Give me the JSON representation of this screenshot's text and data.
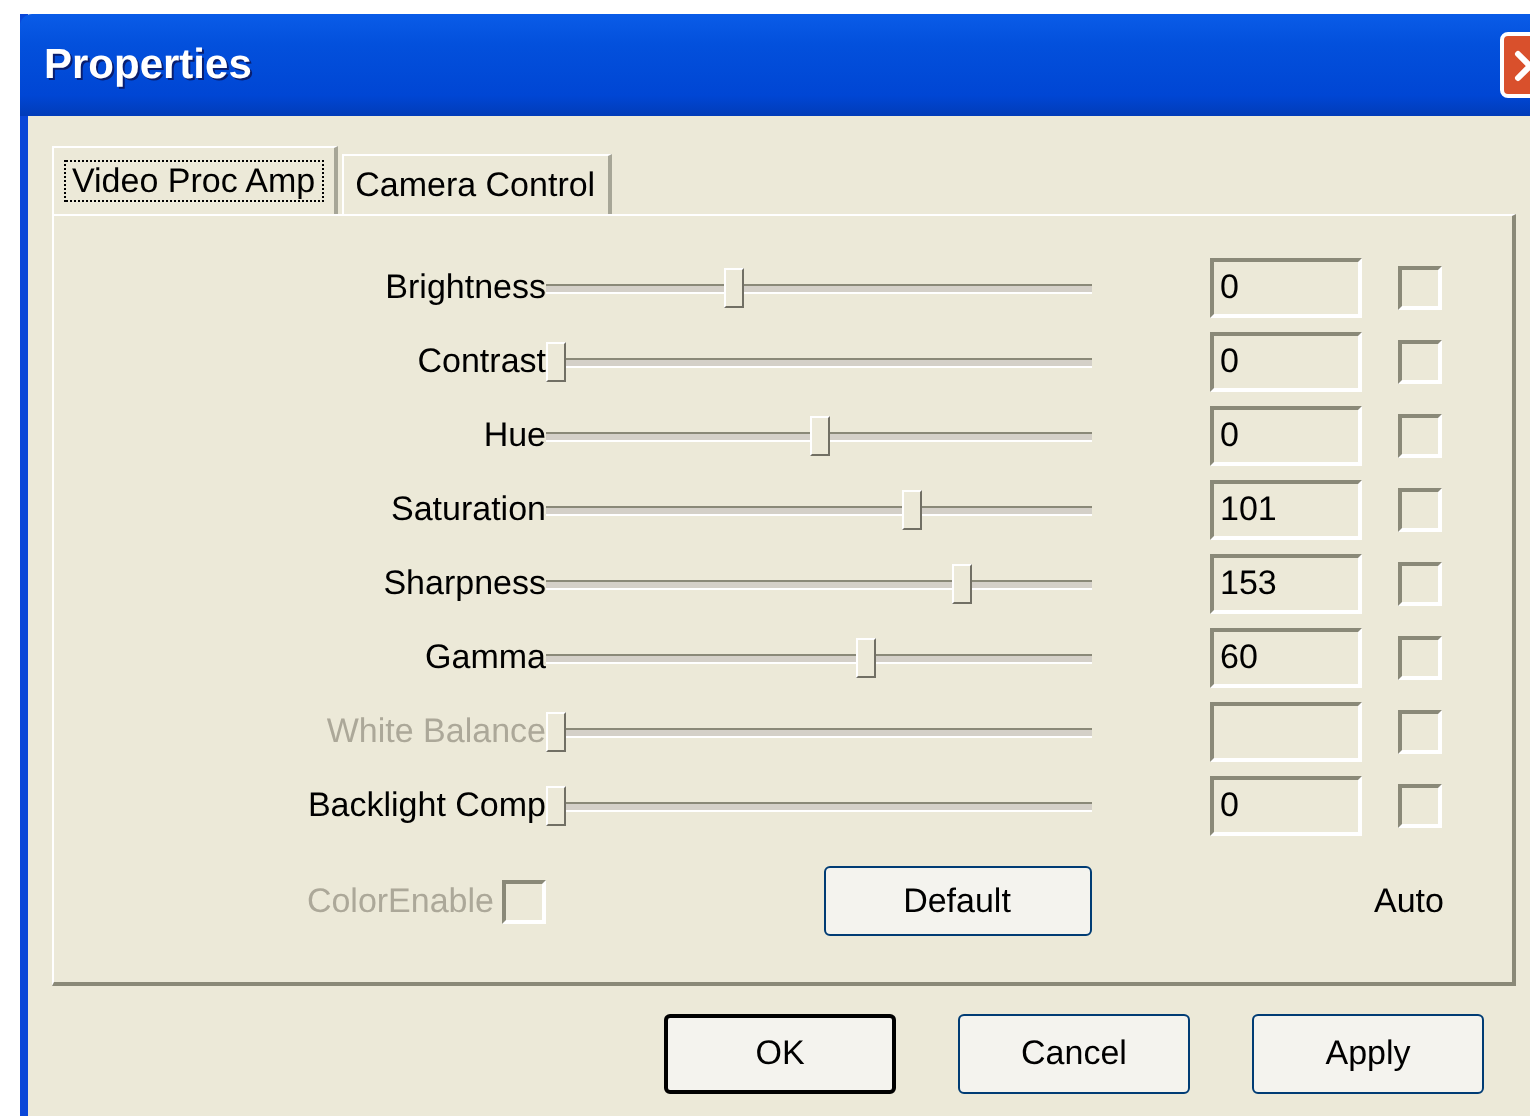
{
  "window": {
    "title": "Properties"
  },
  "tabs": [
    {
      "label": "Video Proc Amp",
      "selected": true
    },
    {
      "label": "Camera Control",
      "selected": false
    }
  ],
  "controls": [
    {
      "name": "Brightness",
      "level": 0.34,
      "value": "0",
      "disabled": false,
      "auto": false
    },
    {
      "name": "Contrast",
      "level": 0,
      "value": "0",
      "disabled": false,
      "auto": false
    },
    {
      "name": "Hue",
      "level": 0.5,
      "value": "0",
      "disabled": false,
      "auto": false
    },
    {
      "name": "Saturation",
      "level": 0.675,
      "value": "101",
      "disabled": false,
      "auto": false
    },
    {
      "name": "Sharpness",
      "level": 0.77,
      "value": "153",
      "disabled": false,
      "auto": false
    },
    {
      "name": "Gamma",
      "level": 0.59,
      "value": "60",
      "disabled": false,
      "auto": false
    },
    {
      "name": "White Balance",
      "level": 0,
      "disabled": true,
      "auto": false
    },
    {
      "name": "Backlight Comp",
      "level": 0,
      "value": "0",
      "disabled": false,
      "auto": false
    }
  ],
  "color_enable": {
    "label": "ColorEnable",
    "disabled": true,
    "checked": false
  },
  "default_button": "Default",
  "auto_label": "Auto",
  "buttons": [
    "OK",
    "Cancel",
    "Apply"
  ]
}
